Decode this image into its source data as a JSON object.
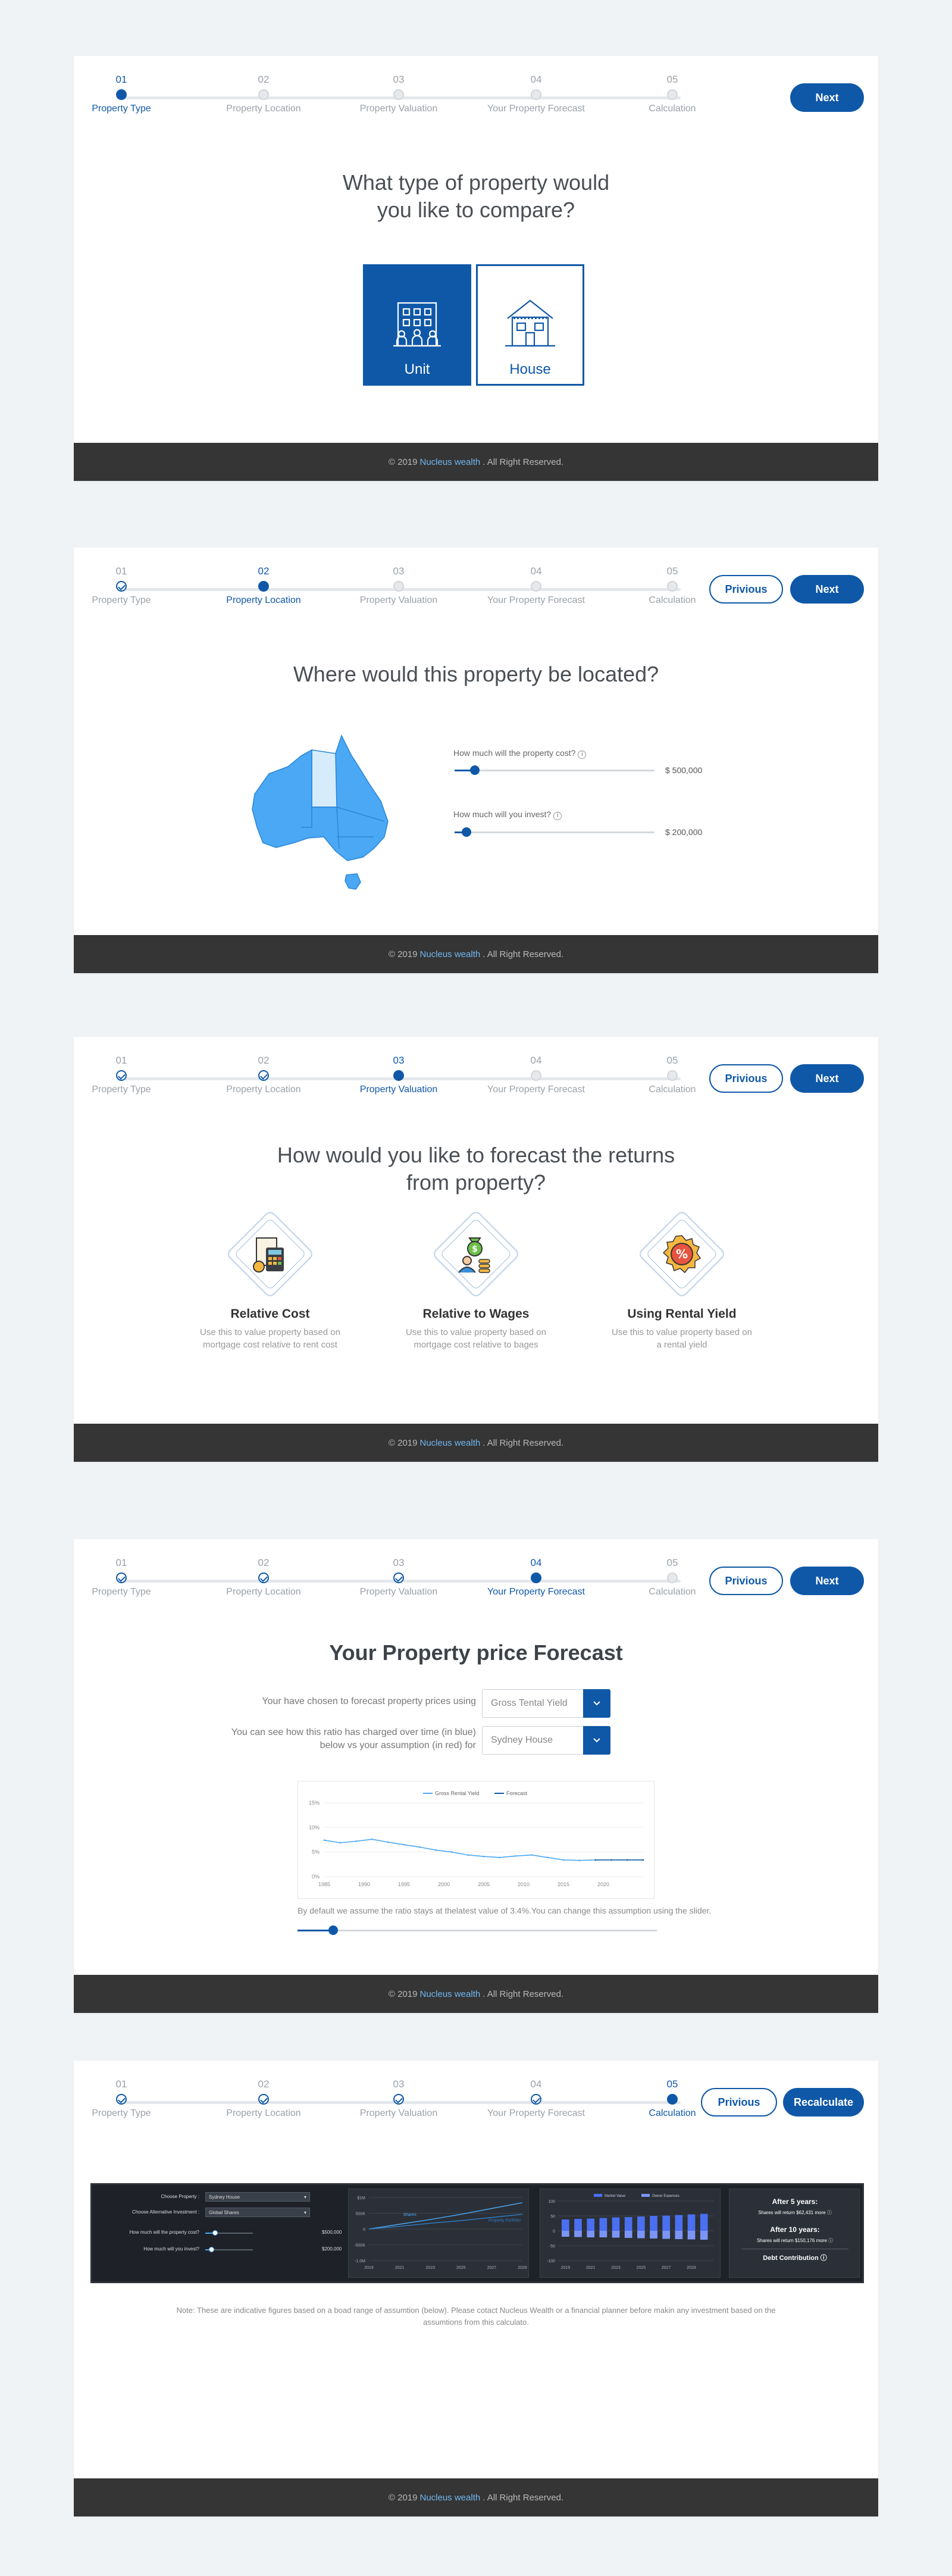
{
  "steps": [
    {
      "num": "01",
      "label": "Property Type"
    },
    {
      "num": "02",
      "label": "Property Location"
    },
    {
      "num": "03",
      "label": "Property Valuation"
    },
    {
      "num": "04",
      "label": "Your Property Forecast"
    },
    {
      "num": "05",
      "label": "Calculation"
    }
  ],
  "buttons": {
    "next": "Next",
    "previous": "Privious",
    "recalculate": "Recalculate"
  },
  "footer": {
    "copyright": "© 2019",
    "brand": "Nucleus wealth",
    "rights": ". All Right Reserved."
  },
  "colors": {
    "primary": "#0f58a8",
    "footer_bg": "#353535",
    "map": "#4aa8f5",
    "map_highlight": "#d7ecfb"
  },
  "screen1": {
    "question_line1": "What type of property would",
    "question_line2": "you like to compare?",
    "options": [
      {
        "label": "Unit",
        "icon": "apartment-building-icon",
        "selected": true
      },
      {
        "label": "House",
        "icon": "house-icon",
        "selected": false
      }
    ]
  },
  "screen2": {
    "question": "Where would this property be located?",
    "cost_question": "How much will the property cost?",
    "cost_value": "$ 500,000",
    "cost_level": 0.1,
    "invest_question": "How much will you invest?",
    "invest_value": "$ 200,000",
    "invest_level": 0.06,
    "map_icon": "australia-map-icon"
  },
  "screen3": {
    "question_line1": "How would you like to forecast the returns",
    "question_line2": "from property?",
    "options": [
      {
        "title": "Relative Cost",
        "desc_line1": "Use this to value property based on",
        "desc_line2": "mortgage cost relative to rent cost",
        "icon": "calculator-icon"
      },
      {
        "title": "Relative to Wages",
        "desc_line1": "Use this to value property based on",
        "desc_line2": "mortgage cost relative to bages",
        "icon": "salary-icon"
      },
      {
        "title": "Using Rental Yield",
        "desc_line1": "Use this to value property based on",
        "desc_line2": "a rental yield",
        "icon": "percent-badge-icon"
      }
    ]
  },
  "screen4": {
    "title": "Your Property price Forecast",
    "method_label": "Your have chosen to forecast property prices using",
    "method_value": "Gross Tental Yield",
    "ratio_label_line1": "You can see how this ratio has charged over time (in blue)",
    "ratio_label_line2": "below vs your assumption (in red) for",
    "location_value": "Sydney House",
    "note": "By default we assume the ratio stays at thelatest value of 3.4%.You can change this assumption using the slider.",
    "slider_level": 0.1
  },
  "screen5": {
    "form": [
      {
        "label": "Choose Property :",
        "value": "Sydney House"
      },
      {
        "label": "Choose Alternative Investment :",
        "value": "Global Shares"
      },
      {
        "label": "How much will the property cost?",
        "value": "$500,000"
      },
      {
        "label": "How much will you invest?",
        "value": "$200,000"
      }
    ],
    "summary": {
      "after5_title": "After 5 years:",
      "after5_text": "Shares will return $62,431 more",
      "after10_title": "After 10 years:",
      "after10_text": "Shares will return $150,176 more",
      "debt_label": "Debt Contribution"
    },
    "note_line1": "Note: These are indicative figures based on a boad range of assumtion (below). Please cotact Nucleus Wealth or a financial planner before makin any investment based on the",
    "note_line2": "assumtions from this calculato."
  },
  "chart_data": [
    {
      "type": "line",
      "legend": [
        "Gross Rental Yield",
        "Forecast"
      ],
      "x": [
        1985,
        1987,
        1989,
        1991,
        1993,
        1995,
        1997,
        1999,
        2001,
        2003,
        2005,
        2007,
        2009,
        2011,
        2013,
        2015,
        2017,
        2019,
        2021,
        2023,
        2025
      ],
      "series": [
        {
          "name": "Gross Rental Yield",
          "values": [
            7.4,
            6.9,
            7.2,
            7.6,
            7.0,
            6.5,
            6.0,
            5.4,
            5.0,
            4.4,
            4.1,
            3.9,
            4.2,
            4.4,
            3.9,
            3.4,
            3.3,
            3.4,
            null,
            null,
            null
          ]
        },
        {
          "name": "Forecast",
          "values": [
            null,
            null,
            null,
            null,
            null,
            null,
            null,
            null,
            null,
            null,
            null,
            null,
            null,
            null,
            null,
            null,
            null,
            3.4,
            3.4,
            3.4,
            3.4
          ]
        }
      ],
      "xticks": [
        "1985",
        "1990",
        "1995",
        "2000",
        "2005",
        "2010",
        "2015",
        "2020"
      ],
      "yticks": [
        "0%",
        "5%",
        "10%",
        "15%"
      ],
      "ylim": [
        0,
        15
      ]
    },
    {
      "type": "line",
      "series": [
        {
          "name": "Shares",
          "values": [
            0,
            45,
            90,
            140,
            195,
            250
          ]
        },
        {
          "name": "Property Portfolio",
          "values": [
            0,
            25,
            55,
            80,
            110,
            140
          ]
        }
      ],
      "x": [
        "2019",
        "2021",
        "2023",
        "2025",
        "2027",
        "2029"
      ],
      "yticks": [
        "$1M",
        "500K",
        "0",
        "-500K",
        "-1.0M"
      ]
    },
    {
      "type": "bar",
      "legend": [
        "Market Value",
        "Owner Expenses"
      ],
      "categories": [
        "2019",
        "2020",
        "2021",
        "2022",
        "2023",
        "2024",
        "2025",
        "2026",
        "2027",
        "2028",
        "2029",
        "2030"
      ],
      "series": [
        {
          "name": "Market Value",
          "values": [
            38,
            40,
            41,
            43,
            45,
            46,
            48,
            50,
            51,
            53,
            55,
            57
          ]
        },
        {
          "name": "Owner Expenses",
          "values": [
            -20,
            -21,
            -22,
            -22,
            -23,
            -24,
            -25,
            -26,
            -27,
            -28,
            -29,
            -30
          ]
        }
      ],
      "yticks": [
        "100",
        "50",
        "0",
        "-50",
        "-100"
      ]
    }
  ]
}
